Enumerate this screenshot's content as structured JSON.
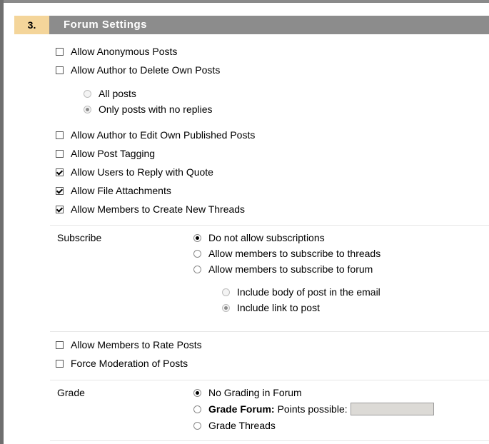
{
  "section": {
    "number": "3.",
    "title": "Forum Settings"
  },
  "options_top": [
    {
      "label": "Allow Anonymous Posts",
      "checked": false
    },
    {
      "label": "Allow Author to Delete Own Posts",
      "checked": false
    }
  ],
  "delete_options": [
    {
      "label": "All posts",
      "selected": false
    },
    {
      "label": "Only posts with no replies",
      "selected": true
    }
  ],
  "options_mid": [
    {
      "label": "Allow Author to Edit Own Published Posts",
      "checked": false
    },
    {
      "label": "Allow Post Tagging",
      "checked": false
    },
    {
      "label": "Allow Users to Reply with Quote",
      "checked": true
    },
    {
      "label": "Allow File Attachments",
      "checked": true
    },
    {
      "label": "Allow Members to Create New Threads",
      "checked": true
    }
  ],
  "subscribe": {
    "label": "Subscribe",
    "options": [
      {
        "label": "Do not allow subscriptions",
        "selected": true
      },
      {
        "label": "Allow members to subscribe to threads",
        "selected": false
      },
      {
        "label": "Allow members to subscribe to forum",
        "selected": false
      }
    ],
    "email_options": [
      {
        "label": "Include body of post in the email",
        "selected": false
      },
      {
        "label": "Include link to post",
        "selected": true
      }
    ]
  },
  "options_bottom": [
    {
      "label": "Allow Members to Rate Posts",
      "checked": false
    },
    {
      "label": "Force Moderation of Posts",
      "checked": false
    }
  ],
  "grade": {
    "label": "Grade",
    "options": [
      {
        "label": "No Grading in Forum",
        "selected": true
      },
      {
        "bold_label": "Grade Forum:",
        "label": "Points possible:",
        "selected": false,
        "points_value": ""
      },
      {
        "label": "Grade Threads",
        "selected": false
      }
    ]
  }
}
